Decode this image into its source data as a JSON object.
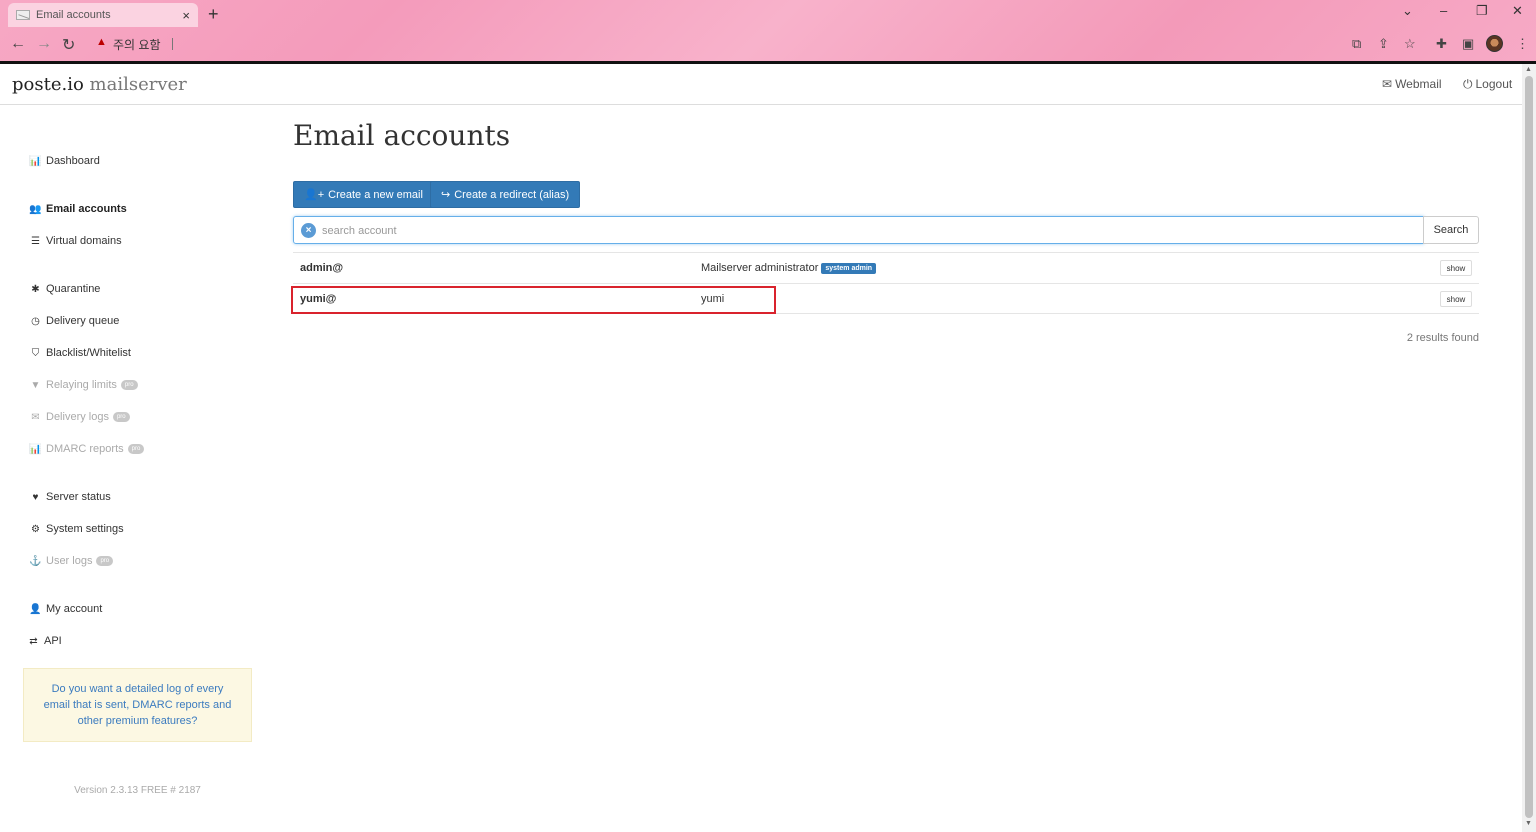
{
  "browser": {
    "tab_title": "Email accounts",
    "new_tab": "+",
    "close_tab": "×",
    "security_warning": "주의 요함",
    "window": {
      "minimize": "–",
      "restore": "❐",
      "close": "✕",
      "dropdown": "⌄"
    }
  },
  "app": {
    "brand_main": "poste.io",
    "brand_sub": "mailserver",
    "top_links": {
      "webmail": "Webmail",
      "logout": "Logout"
    }
  },
  "sidebar": {
    "items": [
      {
        "label": "Dashboard",
        "icon": "bar-chart-icon"
      },
      {
        "label": "Email accounts",
        "icon": "users-icon",
        "active": true
      },
      {
        "label": "Virtual domains",
        "icon": "database-icon"
      },
      {
        "label": "Quarantine",
        "icon": "bug-icon"
      },
      {
        "label": "Delivery queue",
        "icon": "clock-icon"
      },
      {
        "label": "Blacklist/Whitelist",
        "icon": "shield-icon"
      },
      {
        "label": "Relaying limits",
        "icon": "filter-icon",
        "pro": true
      },
      {
        "label": "Delivery logs",
        "icon": "envelope-icon",
        "pro": true
      },
      {
        "label": "DMARC reports",
        "icon": "bar-chart-icon",
        "pro": true
      },
      {
        "label": "Server status",
        "icon": "heartbeat-icon"
      },
      {
        "label": "System settings",
        "icon": "cogs-icon"
      },
      {
        "label": "User logs",
        "icon": "user-secret-icon",
        "pro": true
      },
      {
        "label": "My account",
        "icon": "user-icon"
      },
      {
        "label": "API",
        "icon": "exchange-icon"
      }
    ],
    "pro_label": "pro",
    "promo_text": "Do you want a detailed log of every email that is sent, DMARC reports and other premium features?",
    "version": "Version 2.3.13 FREE # 2187"
  },
  "main": {
    "title": "Email accounts",
    "buttons": {
      "create_email": "Create a new email",
      "create_redirect": "Create a redirect (alias)"
    },
    "search": {
      "placeholder": "search account",
      "button": "Search"
    },
    "accounts": [
      {
        "email": "admin@",
        "name": "Mailserver administrator",
        "badge": "system admin",
        "action": "show"
      },
      {
        "email": "yumi@",
        "name": "yumi",
        "badge": "",
        "action": "show"
      }
    ],
    "results": "2 results found"
  },
  "colors": {
    "primary": "#337ab7",
    "highlight": "#d9232d",
    "promo_bg": "#fcf8e3"
  }
}
